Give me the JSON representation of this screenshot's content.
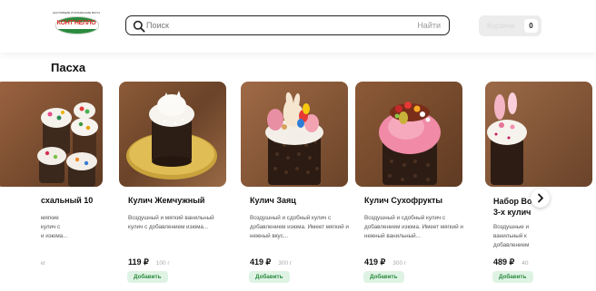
{
  "header": {
    "logo": {
      "tagline": "НАСТОЯЩИЕ ИТАЛЬЯНСКИЕ ВКУСНОСТИ",
      "wordmark": "КОНТ'НЕЛЛО"
    },
    "search": {
      "placeholder": "Поиск",
      "value": "",
      "button_label": "Найти",
      "icon": "search-icon"
    },
    "cart": {
      "label": "Корзина",
      "count": "0"
    }
  },
  "section": {
    "title": "Пасха"
  },
  "products": [
    {
      "name": "схальный 10",
      "desc": "мягкие\nкулич с\nи изюма...",
      "price": "",
      "weight": "кг",
      "add_label": ""
    },
    {
      "name": "Кулич Жемчужный",
      "desc": "Воздушный и мягкий ванильный кулич с добавлением изюма...",
      "price": "119 ₽",
      "weight": "100 г",
      "add_label": "Добавить"
    },
    {
      "name": "Кулич Заяц",
      "desc": "Воздушный и сдобный кулич с добавлением изюма. Имеет мягкий и нежный вкус...",
      "price": "419 ₽",
      "weight": "300 г",
      "add_label": "Добавить"
    },
    {
      "name": "Кулич Сухофрукты",
      "desc": "Воздушный и сдобный кулич с добавлением изюма. Имеет мягкий и нежный ванильный...",
      "price": "419 ₽",
      "weight": "300 г",
      "add_label": "Добавить"
    },
    {
      "name": "Набор Во 3-х кулич",
      "desc": "Воздушные и ванильный к добавлением",
      "price": "489 ₽",
      "weight": "40",
      "add_label": "Добавить"
    }
  ],
  "carousel": {
    "next_icon": "chevron-right-icon"
  },
  "colors": {
    "accent_green": "#2b8a3e",
    "add_button_bg": "#dff3e5",
    "logo_red": "#d6312b"
  }
}
